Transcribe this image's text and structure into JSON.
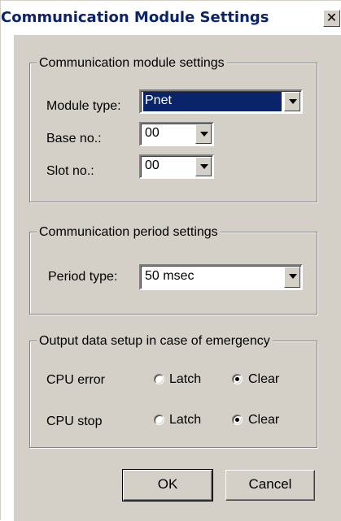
{
  "window": {
    "title": "Communication Module Settings",
    "close_glyph": "✕"
  },
  "module_group": {
    "legend": "Communication module settings",
    "module_type_label": "Module type:",
    "module_type_value": "Pnet",
    "base_no_label": "Base no.:",
    "base_no_value": "00",
    "slot_no_label": "Slot no.:",
    "slot_no_value": "00"
  },
  "period_group": {
    "legend": "Communication period settings",
    "period_type_label": "Period type:",
    "period_type_value": "50 msec"
  },
  "emergency_group": {
    "legend": "Output data setup in case of emergency",
    "cpu_error_label": "CPU error",
    "cpu_stop_label": "CPU stop",
    "latch_label": "Latch",
    "clear_label": "Clear",
    "cpu_error_selected": "Clear",
    "cpu_stop_selected": "Clear"
  },
  "buttons": {
    "ok_label": "OK",
    "cancel_label": "Cancel"
  }
}
